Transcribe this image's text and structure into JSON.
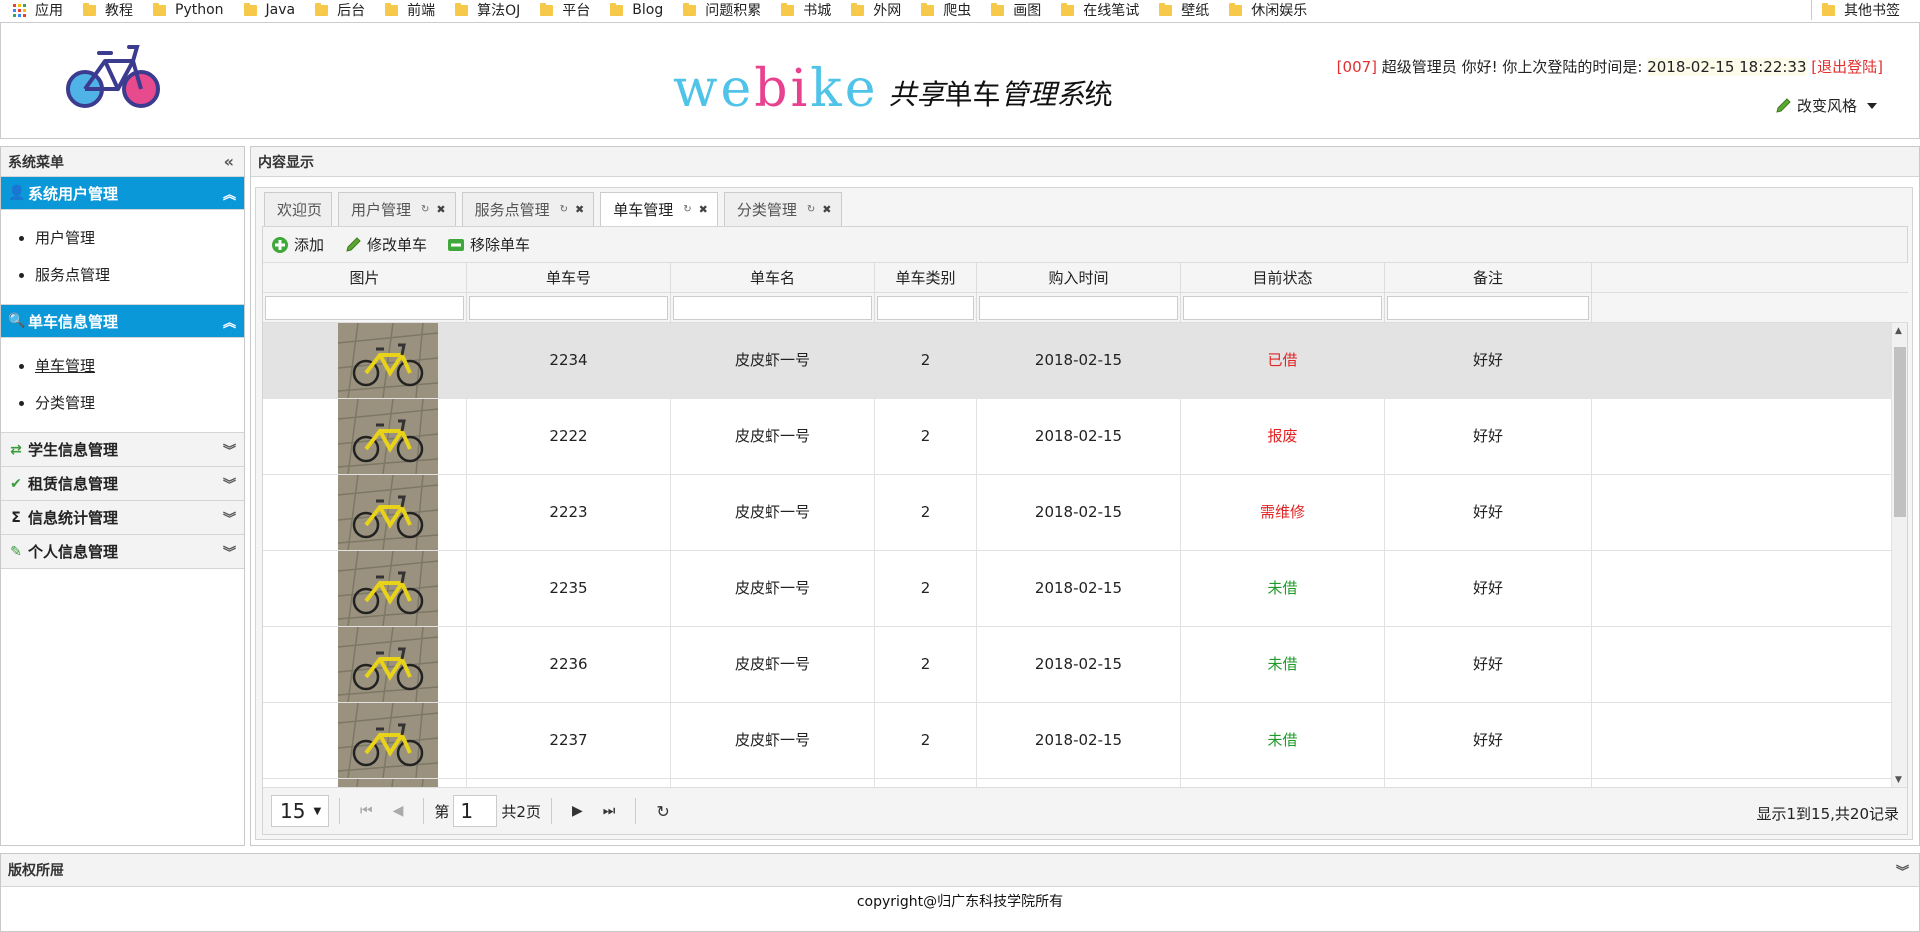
{
  "bookmarks": {
    "apps_label": "应用",
    "folders": [
      "教程",
      "Python",
      "Java",
      "后台",
      "前端",
      "算法OJ",
      "平台",
      "Blog",
      "问题积累",
      "书城",
      "外网",
      "爬虫",
      "画图",
      "在线笔试",
      "壁纸",
      "休闲娱乐"
    ],
    "other": "其他书签"
  },
  "header": {
    "brand_web": "webike",
    "brand_sub_a": "共享",
    "brand_sub_b": "单车",
    "brand_sub_c": "管理系",
    "brand_sub_d": "统",
    "user_id": "[007]",
    "greeting": "超级管理员 你好! 你上次登陆的时间是:",
    "last_login": "2018-02-15 18:22:33",
    "logout": "[退出登陆]",
    "style_label": "改变风格"
  },
  "sidebar": {
    "title": "系统菜单",
    "groups": [
      {
        "label": "系统用户管理",
        "icon": "user-icon",
        "items": [
          "用户管理",
          "服务点管理"
        ]
      },
      {
        "label": "单车信息管理",
        "icon": "search-icon",
        "items": [
          "单车管理",
          "分类管理"
        ]
      },
      {
        "label": "学生信息管理",
        "icon": "exchange-icon"
      },
      {
        "label": "租赁信息管理",
        "icon": "check-icon"
      },
      {
        "label": "信息统计管理",
        "icon": "sigma-icon"
      },
      {
        "label": "个人信息管理",
        "icon": "pencil-icon"
      }
    ]
  },
  "main": {
    "title": "内容显示",
    "tabs": [
      {
        "label": "欢迎页"
      },
      {
        "label": "用户管理"
      },
      {
        "label": "服务点管理"
      },
      {
        "label": "单车管理"
      },
      {
        "label": "分类管理"
      }
    ],
    "toolbar": {
      "add": "添加",
      "edit": "修改单车",
      "remove": "移除单车"
    },
    "columns": [
      "图片",
      "单车号",
      "单车名",
      "单车类别",
      "购入时间",
      "目前状态",
      "备注"
    ],
    "rows": [
      {
        "id": "2234",
        "name": "皮皮虾一号",
        "type": "2",
        "date": "2018-02-15",
        "status": "已借",
        "note": "好好"
      },
      {
        "id": "2222",
        "name": "皮皮虾一号",
        "type": "2",
        "date": "2018-02-15",
        "status": "报废",
        "note": "好好"
      },
      {
        "id": "2223",
        "name": "皮皮虾一号",
        "type": "2",
        "date": "2018-02-15",
        "status": "需维修",
        "note": "好好"
      },
      {
        "id": "2235",
        "name": "皮皮虾一号",
        "type": "2",
        "date": "2018-02-15",
        "status": "未借",
        "note": "好好"
      },
      {
        "id": "2236",
        "name": "皮皮虾一号",
        "type": "2",
        "date": "2018-02-15",
        "status": "未借",
        "note": "好好"
      },
      {
        "id": "2237",
        "name": "皮皮虾一号",
        "type": "2",
        "date": "2018-02-15",
        "status": "未借",
        "note": "好好"
      },
      {
        "id": "",
        "name": "",
        "type": "",
        "date": "",
        "status": "",
        "note": ""
      }
    ],
    "pager": {
      "page_size": "15",
      "page_prefix": "第",
      "page_value": "1",
      "page_total": "共2页",
      "info": "显示1到15,共20记录"
    }
  },
  "footer": {
    "title": "版权所屉",
    "text": "copyright@归广东科技学院所有"
  },
  "colors": {
    "accent": "#0b98d8",
    "status_red": "#e32424",
    "status_green": "#1f9b2a"
  }
}
